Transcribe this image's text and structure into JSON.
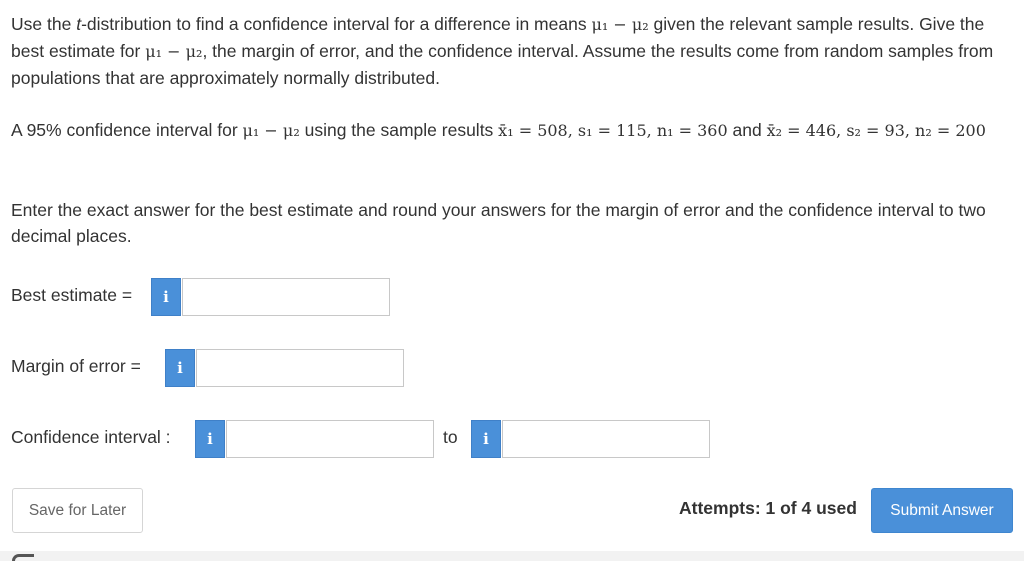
{
  "question": {
    "intro_1": "Use the ",
    "intro_t": "t",
    "intro_2": "-distribution to find a confidence interval for a difference in means ",
    "intro_3": " given the relevant sample results. Give the best estimate for ",
    "intro_4": ", the margin of error, and the confidence interval. Assume the results come from random samples from populations that are approximately normally distributed.",
    "mu_diff": "μ₁ − μ₂",
    "ci_prefix": "A 95% confidence interval for ",
    "ci_using": " using the sample results ",
    "x1_expr": "x̄₁ = 508, s₁ = 115, n₁ = 360",
    "and_word": " and ",
    "x2_expr": "x̄₂ = 446, s₂ = 93, n₂ = 200",
    "instructions": "Enter the exact answer for the best estimate and round your answers for the margin of error and the confidence interval to two decimal places."
  },
  "fields": {
    "best_estimate_label": "Best estimate =",
    "margin_label": "Margin of error =",
    "ci_label": "Confidence interval :",
    "to_label": "to",
    "info_icon": "i",
    "best_estimate_value": "",
    "margin_value": "",
    "ci_lower_value": "",
    "ci_upper_value": ""
  },
  "footer": {
    "save_label": "Save for Later",
    "attempts_text": "Attempts: 1 of 4 used",
    "submit_label": "Submit Answer"
  },
  "colors": {
    "accent": "#4a90d9",
    "text": "#333333"
  }
}
